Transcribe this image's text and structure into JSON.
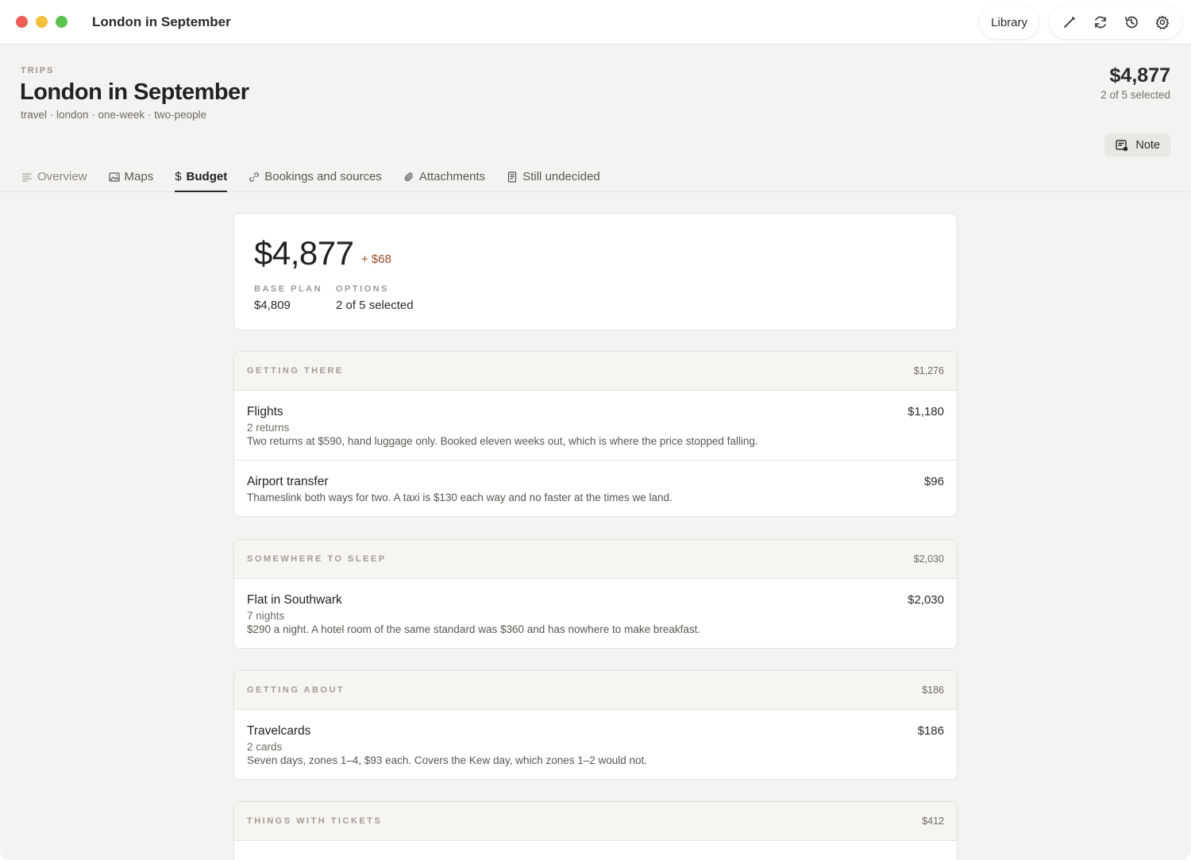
{
  "window": {
    "title": "London in September"
  },
  "toolbar": {
    "library_label": "Library"
  },
  "header": {
    "crumb": "TRIPS",
    "title": "London in September",
    "tags": "travel · london · one-week · two-people",
    "total": "$4,877",
    "selected": "2 of 5 selected",
    "note_label": "Note"
  },
  "tabs": [
    {
      "label": "Overview",
      "icon": "lines-icon"
    },
    {
      "label": "Maps",
      "icon": "image-icon"
    },
    {
      "label": "Budget",
      "icon": "dollar-icon"
    },
    {
      "label": "Bookings and sources",
      "icon": "link-icon"
    },
    {
      "label": "Attachments",
      "icon": "paperclip-icon"
    },
    {
      "label": "Still undecided",
      "icon": "document-icon"
    }
  ],
  "summary": {
    "total": "$4,877",
    "delta": "+ $68",
    "base_label": "BASE PLAN",
    "base_value": "$4,809",
    "options_label": "OPTIONS",
    "options_value": "2 of 5 selected"
  },
  "sections": [
    {
      "name": "GETTING THERE",
      "amount": "$1,276",
      "items": [
        {
          "title": "Flights",
          "amount": "$1,180",
          "qty": "2 returns",
          "desc": "Two returns at $590, hand luggage only. Booked eleven weeks out, which is where the price stopped falling."
        },
        {
          "title": "Airport transfer",
          "amount": "$96",
          "qty": "",
          "desc": "Thameslink both ways for two. A taxi is $130 each way and no faster at the times we land."
        }
      ]
    },
    {
      "name": "SOMEWHERE TO SLEEP",
      "amount": "$2,030",
      "items": [
        {
          "title": "Flat in Southwark",
          "amount": "$2,030",
          "qty": "7 nights",
          "desc": "$290 a night. A hotel room of the same standard was $360 and has nowhere to make breakfast."
        }
      ]
    },
    {
      "name": "GETTING ABOUT",
      "amount": "$186",
      "items": [
        {
          "title": "Travelcards",
          "amount": "$186",
          "qty": "2 cards",
          "desc": "Seven days, zones 1–4, $93 each. Covers the Kew day, which zones 1–2 would not."
        }
      ]
    },
    {
      "name": "THINGS WITH TICKETS",
      "amount": "$412",
      "items": []
    }
  ]
}
